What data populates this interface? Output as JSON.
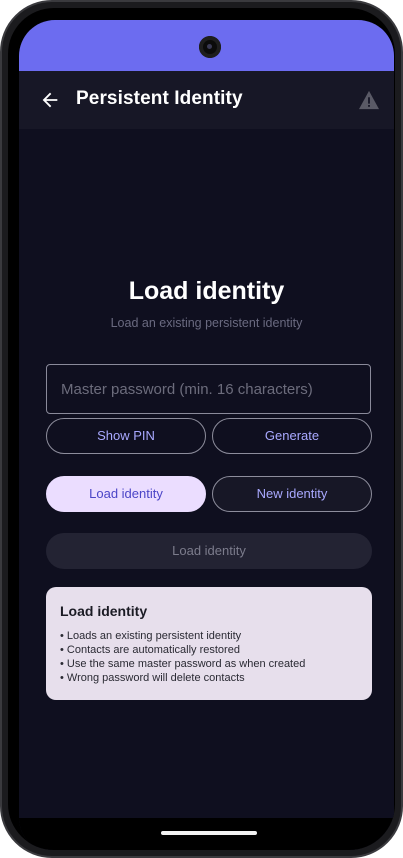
{
  "app_bar": {
    "title": "Persistent Identity",
    "back_icon": "arrow-left-icon",
    "warning_icon": "warning-triangle-icon"
  },
  "main": {
    "heading": "Load identity",
    "subheading": "Load an existing persistent identity",
    "password": {
      "placeholder": "Master password (min. 16 characters)",
      "value": ""
    },
    "show_pin_label": "Show PIN",
    "generate_label": "Generate",
    "mode_toggle": {
      "load_label": "Load identity",
      "new_label": "New identity",
      "selected": "Load identity"
    },
    "primary_button_label": "Load identity"
  },
  "info_card": {
    "title": "Load identity",
    "lines": [
      "• Loads an existing persistent identity",
      "• Contacts are automatically restored",
      "• Use the same master password as when created",
      "• Wrong password will delete contacts"
    ]
  },
  "colors": {
    "status_bar": "#6c6cf0",
    "background": "#0f0f1f",
    "accent": "#a9a9ff",
    "selected_pill": "#ebddff",
    "card": "#e7dfec"
  }
}
